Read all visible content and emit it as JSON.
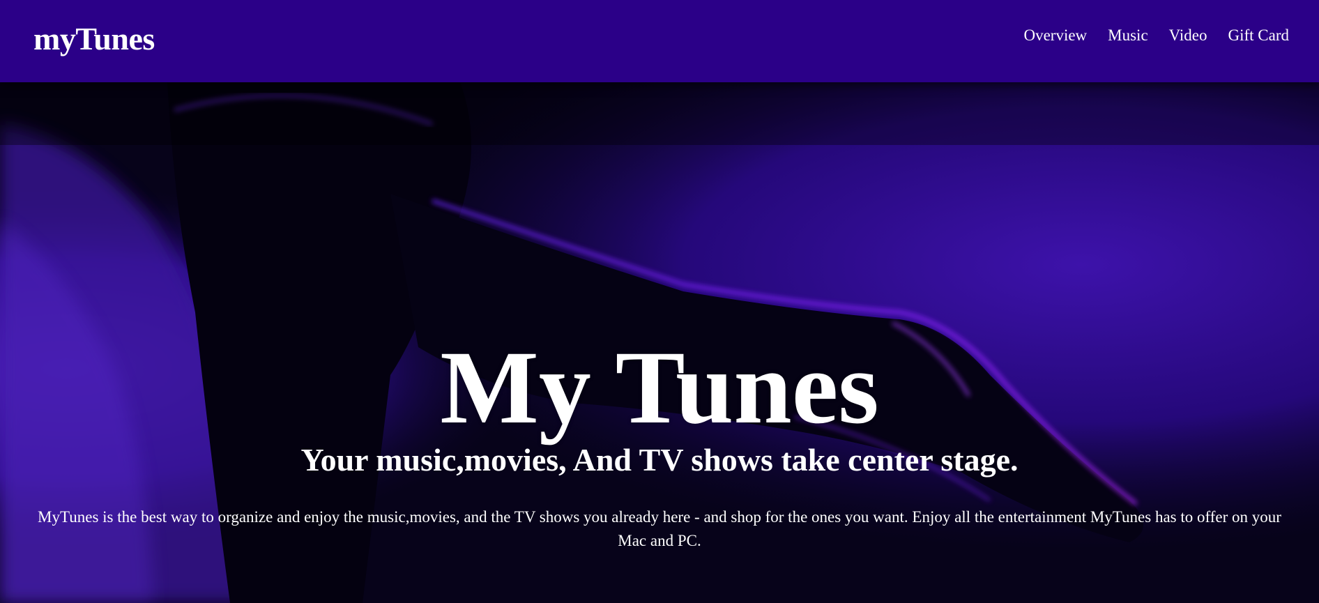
{
  "header": {
    "brand": "myTunes",
    "nav": [
      {
        "label": "Overview"
      },
      {
        "label": "Music"
      },
      {
        "label": "Video"
      },
      {
        "label": "Gift Card"
      }
    ]
  },
  "hero": {
    "title": "My Tunes",
    "subtitle": "Your music,movies, And TV shows take center stage.",
    "description": "MyTunes is the best way to organize and enjoy the music,movies, and the TV shows you already here - and shop for the ones you want. Enjoy all the entertainment MyTunes has to offer on your Mac and PC.",
    "background_image": "purple-lit-hand-holding-microphone"
  },
  "colors": {
    "navbar": "#2b0088",
    "text": "#ffffff",
    "hero_dark": "#06031a",
    "hero_purple": "#3a10a6"
  }
}
